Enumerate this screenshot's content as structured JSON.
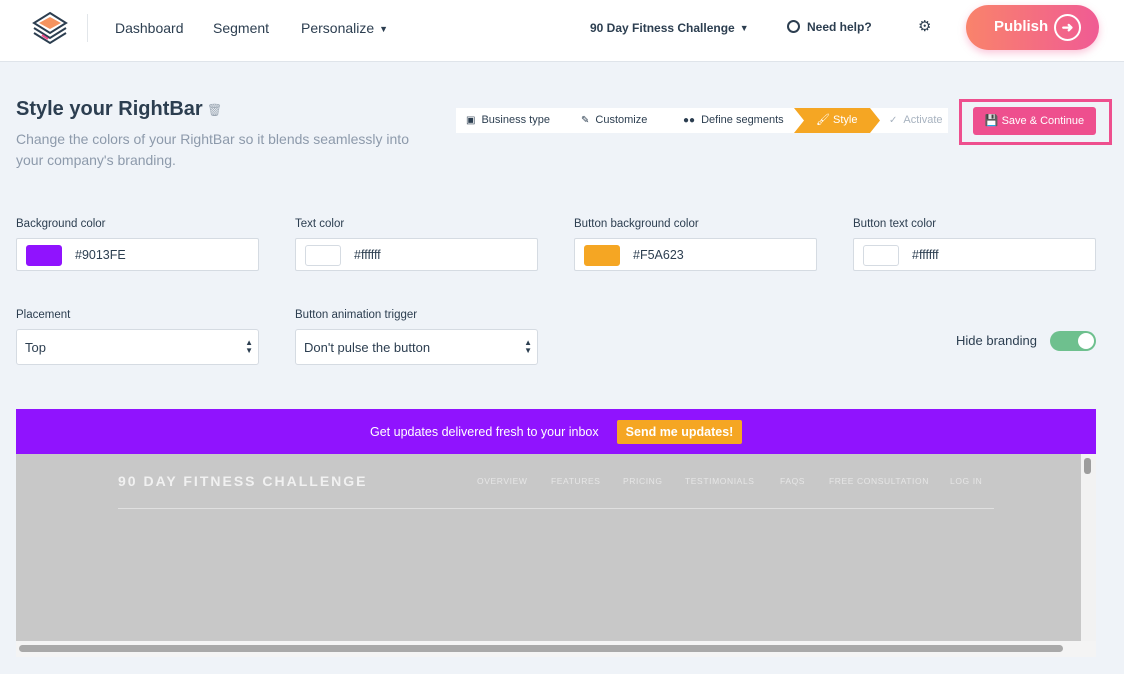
{
  "nav": {
    "dashboard": "Dashboard",
    "segment": "Segment",
    "personalize": "Personalize",
    "project": "90 Day Fitness Challenge",
    "help": "Need help?",
    "publish": "Publish"
  },
  "page": {
    "title": "Style your RightBar",
    "subtitle": "Change the colors of your RightBar so it blends seamlessly into your company's branding."
  },
  "steps": {
    "business_type": "Business type",
    "customize": "Customize",
    "define_segments": "Define segments",
    "style": "Style",
    "activate": "Activate",
    "active_step": "Style"
  },
  "save_button": "Save & Continue",
  "colors": {
    "background": {
      "label": "Background color",
      "value": "#9013FE"
    },
    "text": {
      "label": "Text color",
      "value": "#ffffff"
    },
    "button_background": {
      "label": "Button background color",
      "value": "#F5A623"
    },
    "button_text": {
      "label": "Button text color",
      "value": "#ffffff"
    }
  },
  "placement": {
    "label": "Placement",
    "value": "Top"
  },
  "animation": {
    "label": "Button animation trigger",
    "value": "Don't pulse the button"
  },
  "hide_branding": {
    "label": "Hide branding",
    "enabled": true
  },
  "preview": {
    "bar_text": "Get updates delivered fresh to your inbox",
    "bar_button": "Send me updates!",
    "site_title": "90 DAY FITNESS CHALLENGE",
    "site_nav": [
      "OVERVIEW",
      "FEATURES",
      "PRICING",
      "TESTIMONIALS",
      "FAQS",
      "FREE CONSULTATION",
      "LOG IN"
    ]
  },
  "theme": {
    "accent_pink": "#ee4f8e",
    "step_active": "#f5a623",
    "toggle_on": "#6ec08e"
  }
}
